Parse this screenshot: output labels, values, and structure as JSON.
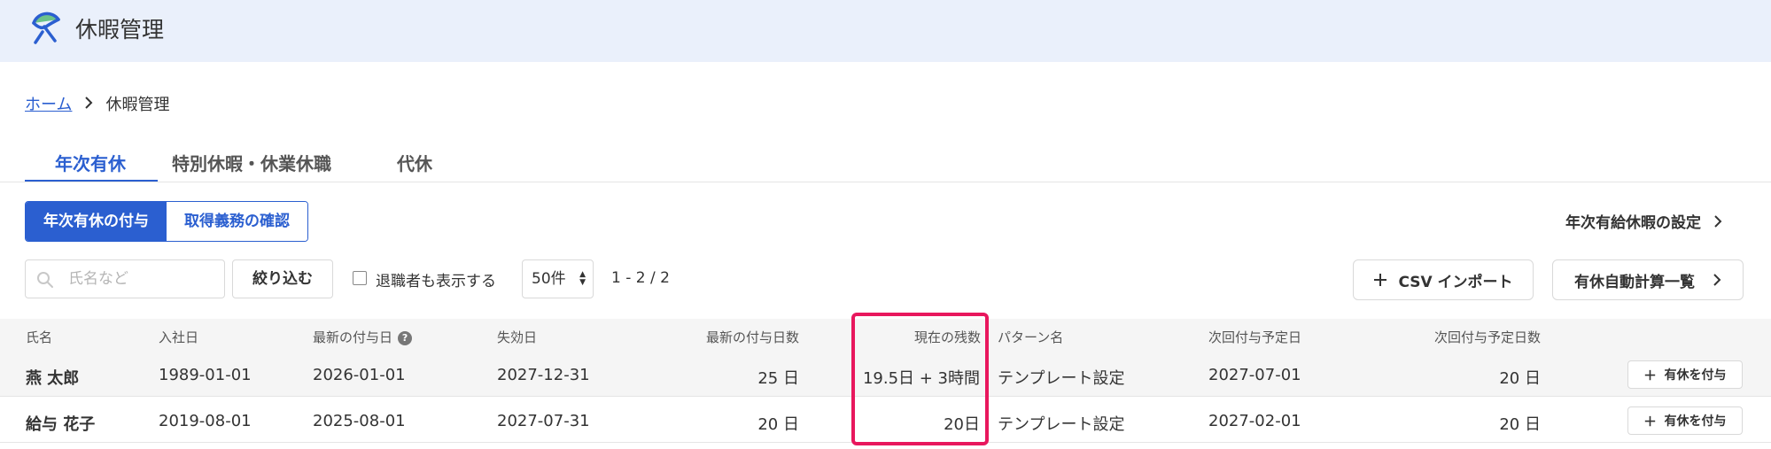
{
  "app": {
    "title": "休暇管理",
    "logo_icon": "umbrella-logo-icon",
    "accent_color": "#2b5fd0",
    "highlight_color": "#e8175d"
  },
  "breadcrumb": {
    "home": "ホーム",
    "current": "休暇管理"
  },
  "tabs": [
    {
      "label": "年次有休",
      "active": true
    },
    {
      "label": "特別休暇・休業休職",
      "active": false
    },
    {
      "label": "代休",
      "active": false
    }
  ],
  "segment": {
    "grant": "年次有休の付与",
    "obligation": "取得義務の確認"
  },
  "settings_link": "年次有給休暇の設定",
  "filters": {
    "search_placeholder": "氏名など",
    "filter_button": "絞り込む",
    "show_retired": "退職者も表示する",
    "show_retired_checked": false,
    "per_page": "50件",
    "page_info": "1 - 2 / 2"
  },
  "actions": {
    "csv_import": "CSV インポート",
    "auto_calc_list": "有休自動計算一覧"
  },
  "table": {
    "headers": {
      "name": "氏名",
      "hire_date": "入社日",
      "latest_grant_date": "最新の付与日",
      "expiry_date": "失効日",
      "latest_grant_days": "最新の付与日数",
      "remaining": "現在の残数",
      "pattern": "パターン名",
      "next_grant_date": "次回付与予定日",
      "next_grant_days": "次回付与予定日数"
    },
    "rows": [
      {
        "name": "燕 太郎",
        "hire_date": "1989-01-01",
        "latest_grant_date": "2026-01-01",
        "expiry_date": "2027-12-31",
        "latest_grant_days": "25 日",
        "remaining": "19.5日 + 3時間",
        "pattern": "テンプレート設定",
        "next_grant_date": "2027-07-01",
        "next_grant_days": "20 日",
        "action": "有休を付与"
      },
      {
        "name": "給与 花子",
        "hire_date": "2019-08-01",
        "latest_grant_date": "2025-08-01",
        "expiry_date": "2027-07-31",
        "latest_grant_days": "20 日",
        "remaining": "20日",
        "pattern": "テンプレート設定",
        "next_grant_date": "2027-02-01",
        "next_grant_days": "20 日",
        "action": "有休を付与"
      }
    ]
  }
}
